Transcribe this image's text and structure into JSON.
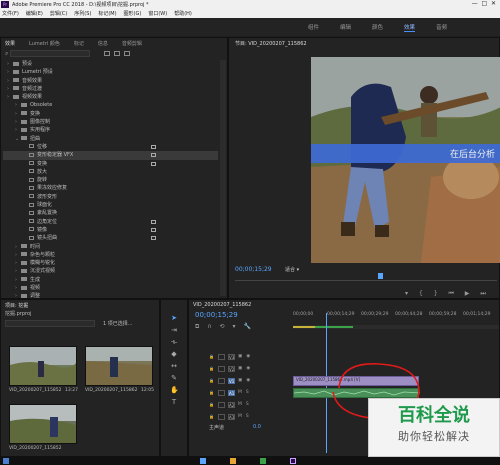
{
  "window": {
    "app_logo": "Pr",
    "title": "Adobe Premiere Pro CC 2018 - D:\\视频项目\\挖掘.prproj *"
  },
  "menu": [
    "文件(F)",
    "编辑(E)",
    "剪辑(C)",
    "序列(S)",
    "标记(M)",
    "图形(G)",
    "窗口(W)",
    "帮助(H)"
  ],
  "workspaces": [
    {
      "label": "组件",
      "active": false
    },
    {
      "label": "编辑",
      "active": false
    },
    {
      "label": "颜色",
      "active": false
    },
    {
      "label": "效果",
      "active": true
    },
    {
      "label": "音频",
      "active": false
    }
  ],
  "effects_panel": {
    "tabs": [
      {
        "label": "效果",
        "active": true
      },
      {
        "label": "Lumetri 颜色",
        "active": false
      },
      {
        "label": "标记",
        "active": false
      },
      {
        "label": "信息",
        "active": false
      },
      {
        "label": "音频剪辑",
        "active": false
      }
    ],
    "search_placeholder": "",
    "items": [
      {
        "label": "预设",
        "type": "folder",
        "depth": 0,
        "selected": false,
        "badge": false
      },
      {
        "label": "Lumetri 预设",
        "type": "folder",
        "depth": 0,
        "selected": false,
        "badge": false
      },
      {
        "label": "音频效果",
        "type": "folder",
        "depth": 0,
        "selected": false,
        "badge": false
      },
      {
        "label": "音频过渡",
        "type": "folder",
        "depth": 0,
        "selected": false,
        "badge": false
      },
      {
        "label": "视频效果",
        "type": "folder",
        "depth": 0,
        "selected": false,
        "badge": false
      },
      {
        "label": "Obsolete",
        "type": "folder",
        "depth": 1,
        "selected": false,
        "badge": false
      },
      {
        "label": "变换",
        "type": "folder",
        "depth": 1,
        "selected": false,
        "badge": false
      },
      {
        "label": "图像控制",
        "type": "folder",
        "depth": 1,
        "selected": false,
        "badge": false
      },
      {
        "label": "实用程序",
        "type": "folder",
        "depth": 1,
        "selected": false,
        "badge": false
      },
      {
        "label": "扭曲",
        "type": "folder-open",
        "depth": 1,
        "selected": false,
        "badge": false
      },
      {
        "label": "位移",
        "type": "fx",
        "depth": 2,
        "selected": false,
        "badge": true
      },
      {
        "label": "变形稳定器 VFX",
        "type": "fx",
        "depth": 2,
        "selected": true,
        "badge": true
      },
      {
        "label": "变换",
        "type": "fx",
        "depth": 2,
        "selected": false,
        "badge": true
      },
      {
        "label": "放大",
        "type": "fx",
        "depth": 2,
        "selected": false,
        "badge": false
      },
      {
        "label": "旋转",
        "type": "fx",
        "depth": 2,
        "selected": false,
        "badge": false
      },
      {
        "label": "果冻效应修复",
        "type": "fx",
        "depth": 2,
        "selected": false,
        "badge": false
      },
      {
        "label": "波形变形",
        "type": "fx",
        "depth": 2,
        "selected": false,
        "badge": false
      },
      {
        "label": "球面化",
        "type": "fx",
        "depth": 2,
        "selected": false,
        "badge": false
      },
      {
        "label": "紊乱置换",
        "type": "fx",
        "depth": 2,
        "selected": false,
        "badge": false
      },
      {
        "label": "边角定位",
        "type": "fx",
        "depth": 2,
        "selected": false,
        "badge": true
      },
      {
        "label": "镜像",
        "type": "fx",
        "depth": 2,
        "selected": false,
        "badge": true
      },
      {
        "label": "镜头扭曲",
        "type": "fx",
        "depth": 2,
        "selected": false,
        "badge": true
      },
      {
        "label": "时间",
        "type": "folder",
        "depth": 1,
        "selected": false,
        "badge": false
      },
      {
        "label": "杂色与颗粒",
        "type": "folder",
        "depth": 1,
        "selected": false,
        "badge": false
      },
      {
        "label": "模糊与锐化",
        "type": "folder",
        "depth": 1,
        "selected": false,
        "badge": false
      },
      {
        "label": "沉浸式视频",
        "type": "folder",
        "depth": 1,
        "selected": false,
        "badge": false
      },
      {
        "label": "生成",
        "type": "folder",
        "depth": 1,
        "selected": false,
        "badge": false
      },
      {
        "label": "视频",
        "type": "folder",
        "depth": 1,
        "selected": false,
        "badge": false
      },
      {
        "label": "调整",
        "type": "folder",
        "depth": 1,
        "selected": false,
        "badge": false
      },
      {
        "label": "过时",
        "type": "folder",
        "depth": 1,
        "selected": false,
        "badge": false
      },
      {
        "label": "过渡",
        "type": "folder",
        "depth": 1,
        "selected": false,
        "badge": false
      }
    ]
  },
  "program_monitor": {
    "tab_label": "节目: VID_20200207_115862",
    "timecode": "00;00;15;29",
    "fit_label": "适合",
    "overlay_text": "在后台分析"
  },
  "project_panel": {
    "tab_label": "项目: 挖掘",
    "project_file": "挖掘.prproj",
    "selection_info": "1 项已选择...",
    "clips": [
      {
        "name": "VID_20200207_115852",
        "duration": "13:27"
      },
      {
        "name": "VID_20200207_115862",
        "duration": "12:05"
      },
      {
        "name": "VID_20200207_115852",
        "duration": "13:27"
      }
    ]
  },
  "timeline": {
    "tab_label": "VID_20200207_115862",
    "timecode": "00;00;15;29",
    "ruler": [
      "00;00;00",
      "00;00;14;29",
      "00;00;29;29",
      "00;00;44;28",
      "00;00;59;28",
      "00;01;14;29"
    ],
    "tracks": [
      {
        "name": "V3",
        "kind": "video"
      },
      {
        "name": "V2",
        "kind": "video"
      },
      {
        "name": "V1",
        "kind": "video",
        "target": true
      },
      {
        "name": "A1",
        "kind": "audio",
        "target": true
      },
      {
        "name": "A2",
        "kind": "audio"
      },
      {
        "name": "A3",
        "kind": "audio"
      }
    ],
    "master_label": "主声道",
    "master_value": "0.0",
    "clip_label": "VID_20200207_115862.mp4 [V]"
  },
  "watermark": {
    "main": "百科全说",
    "sub": "助你轻松解决"
  }
}
